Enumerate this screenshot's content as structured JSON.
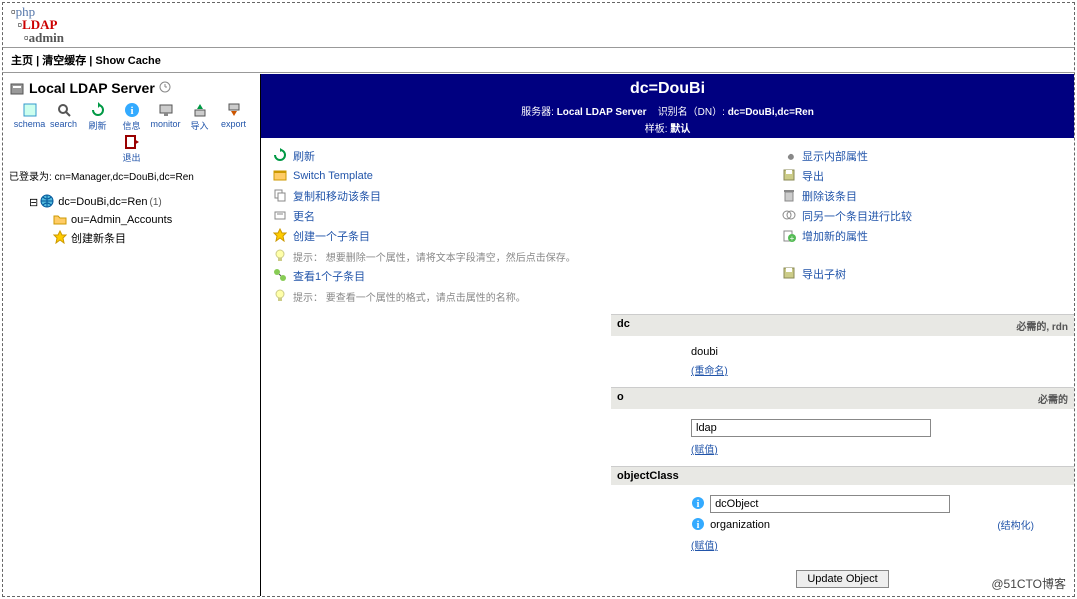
{
  "logo": {
    "p1": "php",
    "p2": "LDAP",
    "p3": "admin"
  },
  "topbar": {
    "home": "主页",
    "purge": "清空缓存",
    "showcache": "Show Cache"
  },
  "sidebar": {
    "server_title": "Local LDAP Server",
    "toolbar": {
      "schema": "schema",
      "search": "search",
      "refresh": "刷新",
      "info": "信息",
      "monitor": "monitor",
      "import": "导入",
      "export": "export",
      "logout": "退出"
    },
    "login_label": "已登录为:",
    "login_dn": "cn=Manager,dc=DouBi,dc=Ren",
    "tree": {
      "root_label": "dc=DouBi,dc=Ren",
      "root_count": "(1)",
      "child1": "ou=Admin_Accounts",
      "newentry": "创建新条目"
    }
  },
  "header": {
    "title": "dc=DouBi",
    "server_lbl": "服务器:",
    "server_val": "Local LDAP Server",
    "dn_lbl": "识别名（DN）:",
    "dn_val": "dc=DouBi,dc=Ren",
    "tpl_lbl": "样板:",
    "tpl_val": "默认"
  },
  "actions_left": {
    "refresh": "刷新",
    "switch_tpl": "Switch Template",
    "copy_move": "复制和移动该条目",
    "rename": "更名",
    "create_child": "创建一个子条目",
    "hint1": "提示： 想要删除一个属性，请将文本字段清空，然后点击保存。",
    "view_child": "查看1个子条目",
    "hint2": "提示： 要查看一个属性的格式，请点击属性的名称。"
  },
  "actions_right": {
    "show_internal": "显示内部属性",
    "export": "导出",
    "delete": "删除该条目",
    "compare": "同另一个条目进行比较",
    "add_attr": "增加新的属性",
    "export_tree": "导出子树"
  },
  "attrs": {
    "dc": {
      "name": "dc",
      "req": "必需的, rdn",
      "value": "doubi",
      "rename": "(重命名)"
    },
    "o": {
      "name": "o",
      "req": "必需的",
      "value": "ldap",
      "link": "(赋值)"
    },
    "objectClass": {
      "name": "objectClass",
      "val1": "dcObject",
      "val2": "organization",
      "structural": "(结构化)",
      "link": "(赋值)"
    }
  },
  "update_btn": "Update Object",
  "watermark": "@51CTO博客"
}
